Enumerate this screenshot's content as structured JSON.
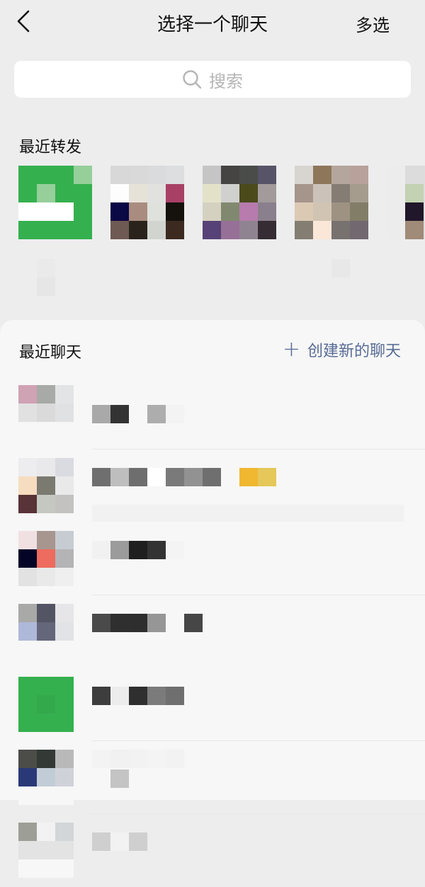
{
  "header": {
    "back_icon": "chevron-left-icon",
    "title": "选择一个聊天",
    "multi_select": "多选"
  },
  "search": {
    "placeholder": "搜索",
    "icon": "search-icon"
  },
  "recent_forward": {
    "label": "最近转发",
    "colors": {
      "accent_green": "#35b04f"
    }
  },
  "sheet": {
    "label": "最近聊天",
    "create_label": "创建新的聊天",
    "link_color": "#576b95"
  }
}
